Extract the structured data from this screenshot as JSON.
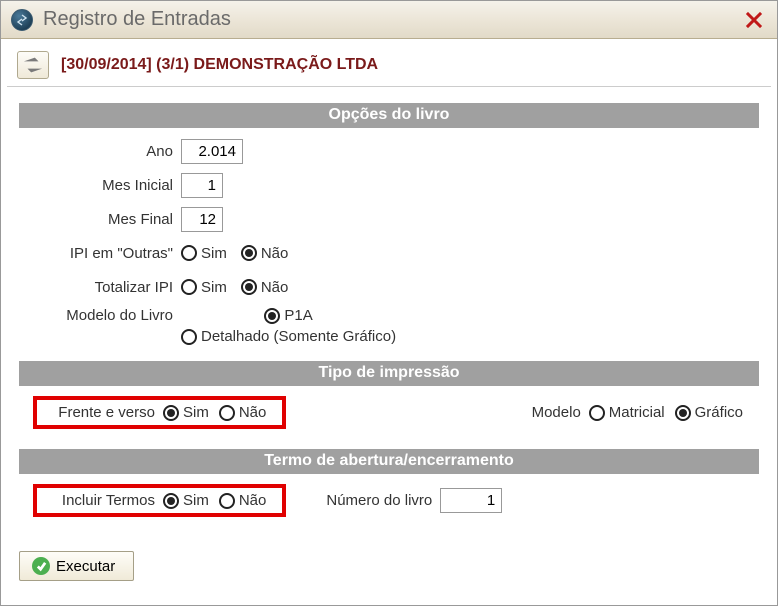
{
  "window": {
    "title": "Registro de Entradas"
  },
  "company_line": "[30/09/2014] (3/1) DEMONSTRAÇÃO LTDA",
  "sections": {
    "opcoes": "Opções do livro",
    "tipo": "Tipo de impressão",
    "termo": "Termo de abertura/encerramento"
  },
  "labels": {
    "ano": "Ano",
    "mes_inicial": "Mes Inicial",
    "mes_final": "Mes Final",
    "ipi_outras": "IPI em \"Outras\"",
    "totalizar_ipi": "Totalizar IPI",
    "modelo_livro": "Modelo do Livro",
    "frente_verso": "Frente e verso",
    "modelo": "Modelo",
    "incluir_termos": "Incluir Termos",
    "numero_livro": "Número do livro"
  },
  "values": {
    "ano": "2.014",
    "mes_inicial": "1",
    "mes_final": "12",
    "numero_livro": "1"
  },
  "options": {
    "sim": "Sim",
    "nao": "Não",
    "p1a": "P1A",
    "detalhado": "Detalhado (Somente Gráfico)",
    "matricial": "Matricial",
    "grafico": "Gráfico"
  },
  "selected": {
    "ipi_outras": "nao",
    "totalizar_ipi": "nao",
    "modelo_livro": "p1a",
    "frente_verso": "sim",
    "modelo": "grafico",
    "incluir_termos": "sim"
  },
  "buttons": {
    "executar": "Executar"
  }
}
